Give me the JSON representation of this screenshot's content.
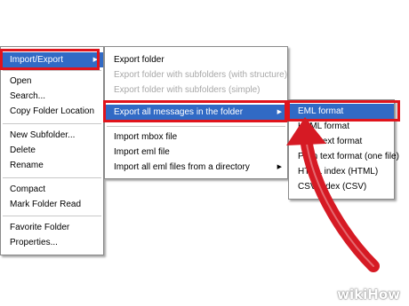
{
  "context_menu": {
    "items": [
      {
        "label": "Import/Export",
        "selected": true,
        "submenu": true
      },
      {
        "label": "Open"
      },
      {
        "label": "Search..."
      },
      {
        "label": "Copy Folder Location"
      },
      {
        "label": "New Subfolder..."
      },
      {
        "label": "Delete"
      },
      {
        "label": "Rename"
      },
      {
        "label": "Compact"
      },
      {
        "label": "Mark Folder Read"
      },
      {
        "label": "Favorite Folder"
      },
      {
        "label": "Properties..."
      }
    ]
  },
  "import_export_menu": {
    "items": [
      {
        "label": "Export folder"
      },
      {
        "label": "Export folder with subfolders (with structure)",
        "disabled": true
      },
      {
        "label": "Export folder with subfolders (simple)",
        "disabled": true
      },
      {
        "label": "Export all messages in the folder",
        "selected": true,
        "submenu": true
      },
      {
        "label": "Import mbox file"
      },
      {
        "label": "Import eml file"
      },
      {
        "label": "Import all eml files from a directory",
        "submenu": true
      }
    ]
  },
  "export_format_menu": {
    "items": [
      {
        "label": "EML format",
        "selected": true
      },
      {
        "label": "HTML format"
      },
      {
        "label": "Plain text format"
      },
      {
        "label": "Plain text format (one file)"
      },
      {
        "label": "HTML index (HTML)"
      },
      {
        "label": "CSV index (CSV)"
      }
    ]
  },
  "colors": {
    "highlight_box": "#e0141c",
    "selection": "#316ac5",
    "arrow": "#d61a24"
  },
  "icons": {
    "submenu_arrow": "submenu-arrow-icon",
    "annotation_arrow": "red-curved-arrow-icon"
  },
  "watermark": "wikiHow"
}
